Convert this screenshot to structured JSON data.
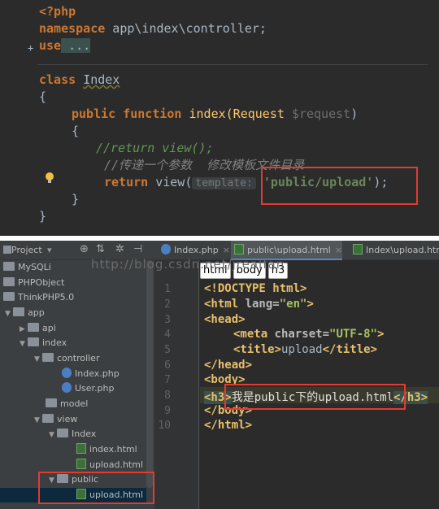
{
  "php": {
    "l1": "<?php",
    "ns_kw": "namespace",
    "ns_val": " app\\index\\controller;",
    "use_kw": "use",
    "use_val": " ...",
    "class_kw": "class",
    "class_name": "Index",
    "brace_open": "{",
    "pub": "public",
    "fn": "function",
    "fn_sig": " index(Request ",
    "param": "$request",
    ")": ")",
    "inner_open": "{",
    "cmt1": "//return view();",
    "cmt2": "//传递一个参数  修改模板文件目录",
    "ret_kw": "return",
    "view": " view(",
    "hint": "template:",
    "arg": "'public/upload'",
    "end": ");",
    "inner_close": "}",
    "brace_close": "}",
    "fold": "+"
  },
  "panel": {
    "title": "Project"
  },
  "tree": [
    {
      "label": "MySQLi"
    },
    {
      "label": "PHPObject"
    },
    {
      "label": "ThinkPHP5.0"
    },
    {
      "label": "app"
    },
    {
      "label": "api"
    },
    {
      "label": "index"
    },
    {
      "label": "controller"
    },
    {
      "label": "Index.php"
    },
    {
      "label": "User.php"
    },
    {
      "label": "model"
    },
    {
      "label": "view"
    },
    {
      "label": "Index"
    },
    {
      "label": "index.html"
    },
    {
      "label": "upload.html"
    },
    {
      "label": "public"
    },
    {
      "label": "upload.html"
    }
  ],
  "tabs": [
    {
      "label": "Index.php"
    },
    {
      "label": "public\\upload.html"
    },
    {
      "label": "Index\\upload.html"
    }
  ],
  "crumbs": [
    "html",
    "body",
    "h3"
  ],
  "watermark": "http://blog.csdn.net/jrealfan",
  "lines": [
    "1",
    "2",
    "3",
    "4",
    "5",
    "6",
    "7",
    "8",
    "9",
    "10"
  ],
  "html": {
    "doctype": "<!DOCTYPE ",
    "doctype_kw": "html",
    ">": ">",
    "html_open": "<html ",
    "lang_attr": "lang=",
    "lang_val": "\"en\"",
    "head_open": "<head>",
    "meta": "<meta ",
    "charset_attr": "charset=",
    "charset_val": "\"UTF-8\"",
    "title_open": "<title>",
    "title_text": "upload",
    "title_close": "</title>",
    "head_close": "</head>",
    "body_open": "<body>",
    "h3_open": "<h3>",
    "h3_text": "我是public下的upload.html",
    "h3_close": "</h3>",
    "body_close": "</body>",
    "html_close": "</html>"
  },
  "colors": {
    "accent": "#e03c31",
    "bg": "#2b2b2b",
    "keyword": "#cc7832",
    "string": "#6a8759"
  }
}
